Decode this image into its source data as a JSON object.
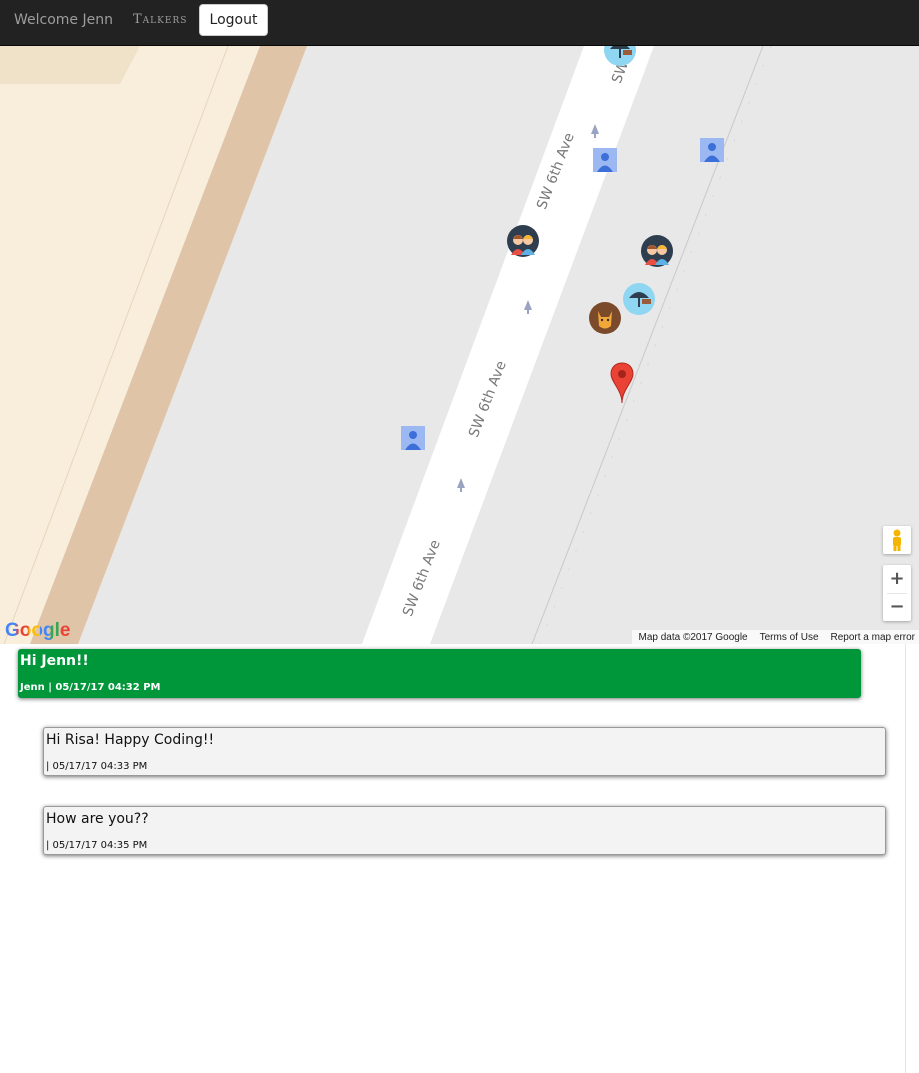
{
  "nav": {
    "welcome": "Welcome Jenn",
    "talkers": "Talkers",
    "logout": "Logout"
  },
  "map": {
    "street_labels": [
      "SW 6th Ave",
      "SW 6th Ave",
      "SW 6th Ave",
      "SW"
    ],
    "google_logo": "Google",
    "attribution": {
      "map_data": "Map data ©2017 Google",
      "terms": "Terms of Use",
      "report": "Report a map error"
    },
    "zoom_in": "+",
    "zoom_out": "−"
  },
  "messages": [
    {
      "text": "Hi Jenn!!",
      "meta": "Jenn | 05/17/17 04:32 PM"
    },
    {
      "text": "Hi Risa! Happy Coding!!",
      "meta": "| 05/17/17 04:33 PM"
    },
    {
      "text": "How are you??",
      "meta": "| 05/17/17 04:35 PM"
    }
  ],
  "colors": {
    "navbar": "#222222",
    "own_message": "#00963a",
    "other_message": "#f3f3f3",
    "map_background": "#e8e8e8",
    "map_building": "#f8eedb",
    "map_band": "#dfc4a8"
  }
}
